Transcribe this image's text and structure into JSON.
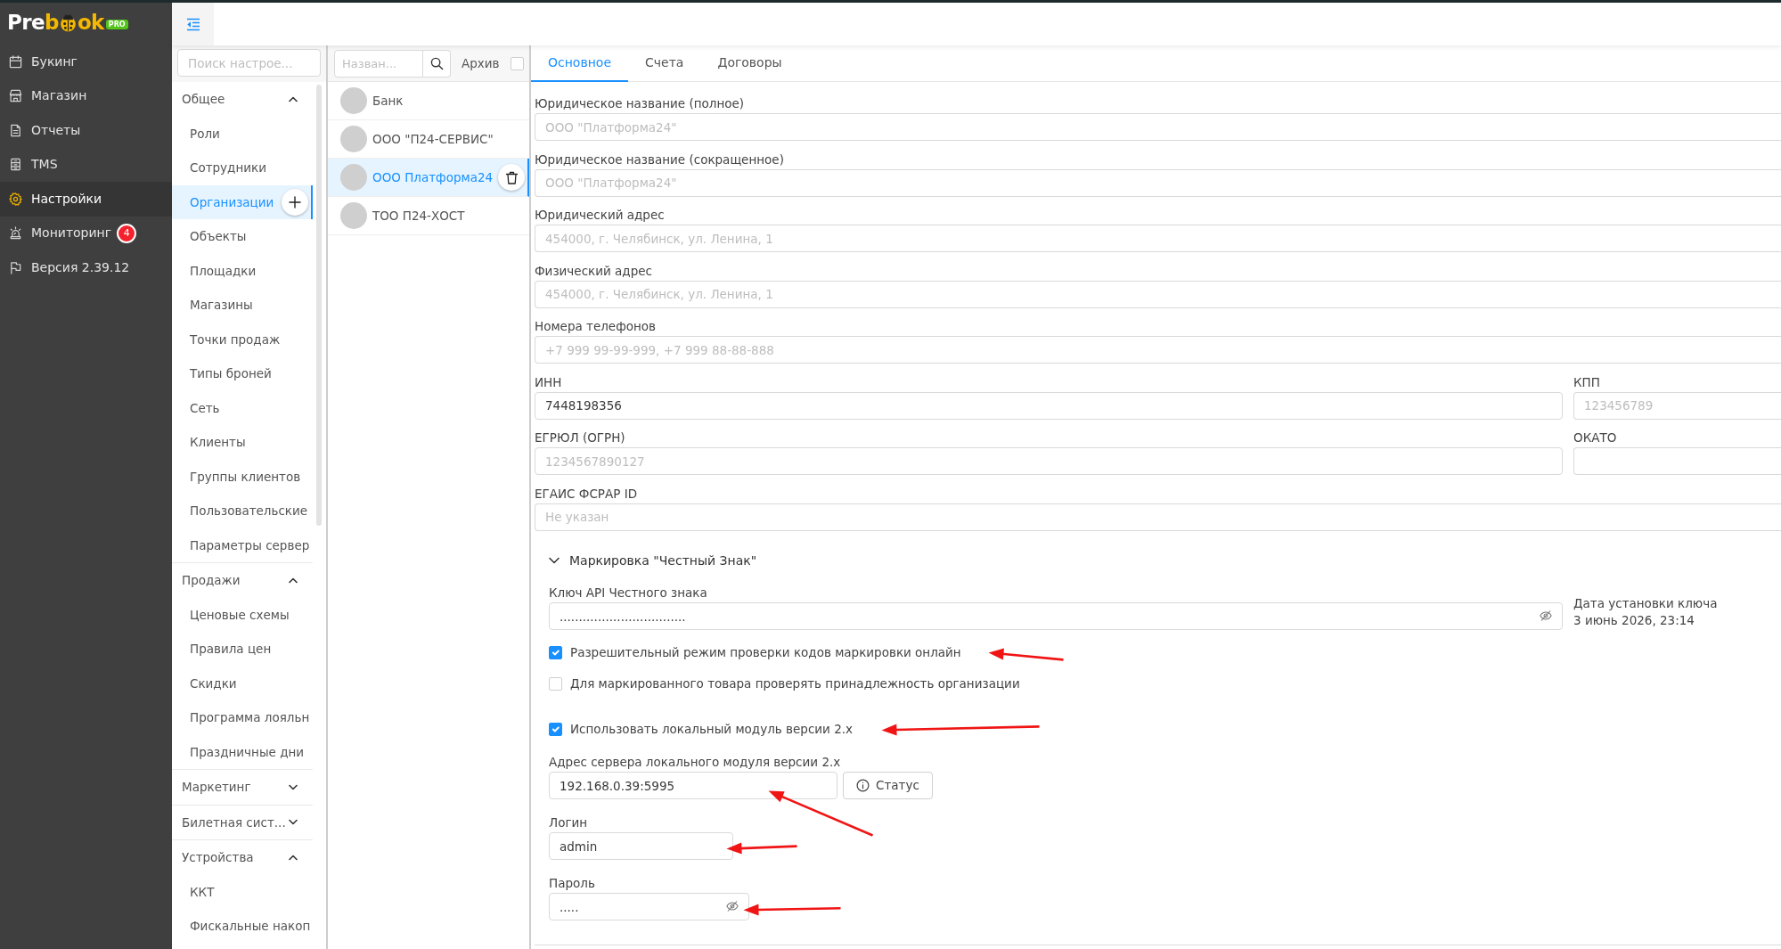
{
  "logo": {
    "lead": "Pre",
    "accent": "b",
    "tail": "ok",
    "badge": "PRO"
  },
  "nav": {
    "items": [
      {
        "label": "Букинг",
        "selected": false
      },
      {
        "label": "Магазин",
        "selected": false
      },
      {
        "label": "Отчеты",
        "selected": false
      },
      {
        "label": "TMS",
        "selected": false
      },
      {
        "label": "Настройки",
        "selected": true
      },
      {
        "label": "Мониторинг",
        "selected": false,
        "badge": "4"
      },
      {
        "label": "Версия 2.39.12",
        "selected": false
      }
    ]
  },
  "settings_menu": {
    "search": {
      "placeholder": "Поиск настрое..."
    },
    "groups": [
      {
        "title": "Общее",
        "expanded": true,
        "items": [
          {
            "label": "Роли",
            "selected": false
          },
          {
            "label": "Сотрудники",
            "selected": false
          },
          {
            "label": "Организации",
            "selected": true
          },
          {
            "label": "Объекты",
            "selected": false
          },
          {
            "label": "Площадки",
            "selected": false
          },
          {
            "label": "Магазины",
            "selected": false
          },
          {
            "label": "Точки продаж",
            "selected": false
          },
          {
            "label": "Типы броней",
            "selected": false
          },
          {
            "label": "Сеть",
            "selected": false
          },
          {
            "label": "Клиенты",
            "selected": false
          },
          {
            "label": "Группы клиентов",
            "selected": false
          },
          {
            "label": "Пользовательские",
            "selected": false
          },
          {
            "label": "Параметры сервер",
            "selected": false
          }
        ]
      },
      {
        "title": "Продажи",
        "expanded": true,
        "items": [
          {
            "label": "Ценовые схемы",
            "selected": false
          },
          {
            "label": "Правила цен",
            "selected": false
          },
          {
            "label": "Скидки",
            "selected": false
          },
          {
            "label": "Программа лояльн",
            "selected": false
          },
          {
            "label": "Праздничные дни",
            "selected": false
          }
        ]
      },
      {
        "title": "Маркетинг",
        "expanded": false
      },
      {
        "title": "Билетная сист...",
        "expanded": false
      },
      {
        "title": "Устройства",
        "expanded": true,
        "items": [
          {
            "label": "ККТ",
            "selected": false
          },
          {
            "label": "Фискальные накоп",
            "selected": false
          }
        ]
      }
    ]
  },
  "org_list": {
    "search": {
      "placeholder": "Назван..."
    },
    "archive": {
      "label": "Архив",
      "checked": false
    },
    "items": [
      {
        "name": "Банк",
        "selected": false
      },
      {
        "name": "ООО \"П24-СЕРВИС\"",
        "selected": false
      },
      {
        "name": "ООО Платформа24",
        "selected": true
      },
      {
        "name": "ТОО П24-ХОСТ",
        "selected": false
      }
    ]
  },
  "tabs": [
    {
      "label": "Основное",
      "selected": true
    },
    {
      "label": "Счета",
      "selected": false
    },
    {
      "label": "Договоры",
      "selected": false
    }
  ],
  "form": {
    "rows": [
      {
        "fields": [
          {
            "label": "Юридическое название (полное)",
            "placeholder": "ООО \"Платформа24\""
          }
        ]
      },
      {
        "fields": [
          {
            "label": "Юридическое название (сокращенное)",
            "placeholder": "ООО \"Платформа24\""
          }
        ]
      },
      {
        "fields": [
          {
            "label": "Юридический адрес",
            "placeholder": "454000, г. Челябинск, ул. Ленина, 1"
          }
        ]
      },
      {
        "fields": [
          {
            "label": "Физический адрес",
            "placeholder": "454000, г. Челябинск, ул. Ленина, 1"
          }
        ]
      },
      {
        "fields": [
          {
            "label": "Номера телефонов",
            "placeholder": "+7 999 99-99-999, +7 999 88-88-888"
          }
        ]
      },
      {
        "fields": [
          {
            "label": "ИНН",
            "value": "7448198356"
          },
          {
            "label": "КПП",
            "placeholder": "123456789"
          }
        ]
      },
      {
        "fields": [
          {
            "label": "ЕГРЮЛ (ОГРН)",
            "placeholder": "1234567890127"
          },
          {
            "label": "ОКАТО"
          }
        ]
      },
      {
        "fields": [
          {
            "label": "ЕГАИС ФСРАР ID",
            "placeholder": "Не указан"
          }
        ]
      }
    ]
  },
  "marking": {
    "title": "Маркировка \"Честный Знак\"",
    "expanded": true,
    "api_key": {
      "label": "Ключ API Честного знака",
      "value": "................................."
    },
    "key_date": {
      "label": "Дата установки ключа",
      "value": "3 июнь 2026, 23:14"
    },
    "options": [
      {
        "label": "Разрешительный режим проверки кодов маркировки онлайн",
        "checked": true,
        "arrow": true
      },
      {
        "label": "Для маркированного товара проверять принадлежность организации",
        "checked": false,
        "arrow": false
      },
      {
        "label": "Использовать локальный модуль версии 2.x",
        "checked": true,
        "arrow": true
      }
    ],
    "server": {
      "label": "Адрес сервера локального модуля версии 2.x",
      "value": "192.168.0.39:5995",
      "button": "Статус",
      "arrow": true
    },
    "login": {
      "label": "Логин",
      "value": "admin",
      "arrow": true
    },
    "password": {
      "label": "Пароль",
      "value": ".....",
      "arrow": true
    }
  }
}
